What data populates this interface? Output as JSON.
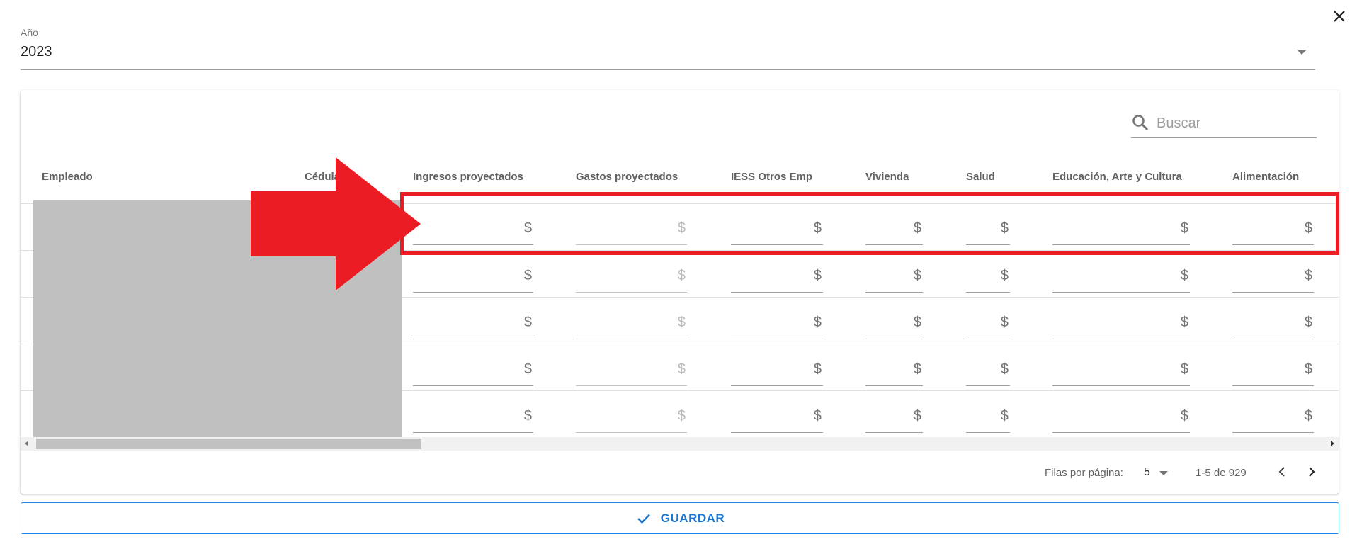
{
  "dialog": {
    "close_label": "×"
  },
  "year_select": {
    "label": "Año",
    "value": "2023"
  },
  "search": {
    "placeholder": "Buscar"
  },
  "table": {
    "columns": [
      "Empleado",
      "Cédula",
      "Ingresos proyectados",
      "Gastos proyectados",
      "IESS Otros Emp",
      "Vivienda",
      "Salud",
      "Educación, Arte y Cultura",
      "Alimentación"
    ],
    "currency_symbol": "$",
    "row_count": 5
  },
  "pagination": {
    "rows_per_page_label": "Filas por página:",
    "rows_per_page_value": "5",
    "range_text": "1-5 de 929"
  },
  "actions": {
    "save_label": "GUARDAR"
  },
  "colors": {
    "accent": "#1976d2",
    "annotation_red": "#ec1c24",
    "redaction_gray": "#c0c0c0"
  },
  "icons": {
    "close": "close-icon",
    "dropdown": "chevron-down-icon",
    "search": "search-icon",
    "prev": "chevron-left-icon",
    "next": "chevron-right-icon",
    "save": "check-icon"
  }
}
